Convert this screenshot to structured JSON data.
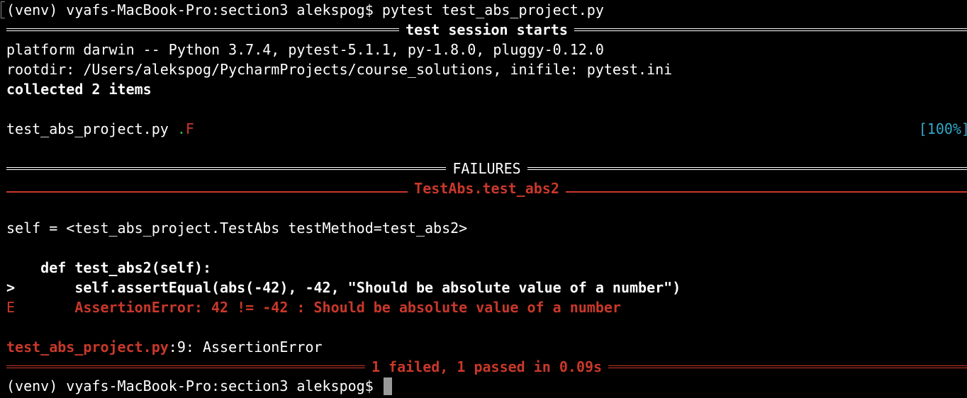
{
  "colors": {
    "background": "#000000",
    "text": "#ffffff",
    "error_red": "#c9382a",
    "pass_green": "#2dbd3a",
    "progress_cyan": "#31a9c9",
    "cursor": "#9a9a9a"
  },
  "prompt": {
    "text": "(venv) vyafs-MacBook-Pro:section3 alekspog$ ",
    "command": "pytest test_abs_project.py"
  },
  "session": {
    "header": "test session starts",
    "platform": "platform darwin -- Python 3.7.4, pytest-5.1.1, py-1.8.0, pluggy-0.12.0",
    "rootdir": "rootdir: /Users/alekspog/PycharmProjects/course_solutions, inifile: pytest.ini",
    "collected": "collected 2 items"
  },
  "results": {
    "file": "test_abs_project.py ",
    "pass_mark": ".",
    "fail_mark": "F",
    "progress": "[100%]"
  },
  "failures": {
    "header": "FAILURES",
    "test_header": "TestAbs.test_abs2",
    "self_line": "self = <test_abs_project.TestAbs testMethod=test_abs2>",
    "def_line": "    def test_abs2(self):",
    "arrow": ">",
    "assert_line": "       self.assertEqual(abs(-42), -42, \"Should be absolute value of a number\")",
    "error_marker": "E",
    "error_line": "       AssertionError: 42 != -42 : Should be absolute value of a number",
    "location_file": "test_abs_project.py",
    "location_rest": ":9: AssertionError"
  },
  "summary": {
    "text": "1 failed, 1 passed in 0.09s"
  },
  "final_prompt": {
    "text": "(venv) vyafs-MacBook-Pro:section3 alekspog$ "
  }
}
